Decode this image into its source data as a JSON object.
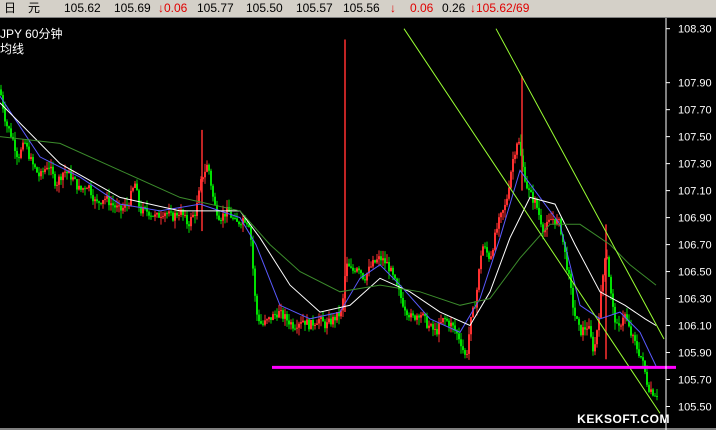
{
  "quote_bar": {
    "f1": "日",
    "f2": "元",
    "f3": "105.62",
    "f4": "105.69",
    "f5": "↓0.06",
    "f6": "105.77",
    "f7": "105.50",
    "f8": "105.57",
    "f9": "105.56",
    "f10": "↓",
    "f11": "0.06",
    "f12": "0.26",
    "f13": "↓105.62/69"
  },
  "chart_labels": {
    "symbol_period": "JPY  60分钟",
    "ma_label": "均线"
  },
  "watermark": "KEKSOFT.COM",
  "colors": {
    "up_candle": "#ff3030",
    "down_candle": "#00e000",
    "support_line": "#ff00ff",
    "channel": "#99ff33",
    "ma_fast": "#5a5aff",
    "ma_mid": "#ffffff",
    "ma_slow": "#3c8c2c",
    "axis": "#ffffff"
  },
  "chart_data": {
    "type": "candlestick",
    "period": "60分钟",
    "ylim": [
      105.45,
      108.35
    ],
    "y_ticks": [
      "108.30",
      "107.90",
      "107.70",
      "107.50",
      "107.30",
      "107.10",
      "106.90",
      "106.70",
      "106.50",
      "106.30",
      "106.10",
      "105.90",
      "105.70",
      "105.50"
    ],
    "close_path": [
      [
        0,
        107.85
      ],
      [
        6,
        107.6
      ],
      [
        12,
        107.5
      ],
      [
        18,
        107.35
      ],
      [
        25,
        107.45
      ],
      [
        32,
        107.3
      ],
      [
        40,
        107.2
      ],
      [
        48,
        107.3
      ],
      [
        56,
        107.15
      ],
      [
        64,
        107.25
      ],
      [
        72,
        107.2
      ],
      [
        80,
        107.1
      ],
      [
        88,
        107.15
      ],
      [
        96,
        107.0
      ],
      [
        104,
        107.05
      ],
      [
        112,
        107.0
      ],
      [
        120,
        106.95
      ],
      [
        128,
        107.0
      ],
      [
        135,
        107.15
      ],
      [
        140,
        106.95
      ],
      [
        148,
        106.95
      ],
      [
        156,
        106.9
      ],
      [
        164,
        106.95
      ],
      [
        172,
        106.9
      ],
      [
        180,
        106.95
      ],
      [
        188,
        106.85
      ],
      [
        196,
        106.95
      ],
      [
        202,
        107.2
      ],
      [
        208,
        107.3
      ],
      [
        214,
        107.0
      ],
      [
        220,
        106.9
      ],
      [
        228,
        106.95
      ],
      [
        236,
        106.85
      ],
      [
        244,
        106.9
      ],
      [
        250,
        106.85
      ],
      [
        256,
        106.2
      ],
      [
        262,
        106.1
      ],
      [
        270,
        106.15
      ],
      [
        278,
        106.2
      ],
      [
        286,
        106.15
      ],
      [
        294,
        106.1
      ],
      [
        302,
        106.15
      ],
      [
        310,
        106.1
      ],
      [
        318,
        106.15
      ],
      [
        326,
        106.1
      ],
      [
        334,
        106.15
      ],
      [
        342,
        106.2
      ],
      [
        346,
        106.55
      ],
      [
        352,
        106.5
      ],
      [
        358,
        106.55
      ],
      [
        364,
        106.45
      ],
      [
        372,
        106.55
      ],
      [
        380,
        106.6
      ],
      [
        388,
        106.55
      ],
      [
        396,
        106.4
      ],
      [
        404,
        106.25
      ],
      [
        412,
        106.15
      ],
      [
        420,
        106.2
      ],
      [
        428,
        106.1
      ],
      [
        436,
        106.05
      ],
      [
        444,
        106.15
      ],
      [
        452,
        106.1
      ],
      [
        460,
        106.0
      ],
      [
        466,
        105.85
      ],
      [
        470,
        106.1
      ],
      [
        476,
        106.3
      ],
      [
        482,
        106.7
      ],
      [
        490,
        106.6
      ],
      [
        498,
        106.85
      ],
      [
        506,
        107.0
      ],
      [
        512,
        107.3
      ],
      [
        518,
        107.5
      ],
      [
        522,
        107.3
      ],
      [
        528,
        107.1
      ],
      [
        536,
        107.0
      ],
      [
        544,
        106.8
      ],
      [
        552,
        106.9
      ],
      [
        560,
        106.85
      ],
      [
        568,
        106.5
      ],
      [
        574,
        106.2
      ],
      [
        580,
        106.05
      ],
      [
        588,
        106.1
      ],
      [
        594,
        105.9
      ],
      [
        600,
        106.25
      ],
      [
        606,
        106.7
      ],
      [
        612,
        106.25
      ],
      [
        618,
        106.05
      ],
      [
        624,
        106.2
      ],
      [
        630,
        106.05
      ],
      [
        636,
        105.95
      ],
      [
        642,
        105.85
      ],
      [
        648,
        105.65
      ],
      [
        654,
        105.6
      ],
      [
        658,
        105.6
      ]
    ],
    "support_level": 105.79,
    "channel_upper": [
      [
        404,
        108.3
      ],
      [
        660,
        105.45
      ]
    ],
    "channel_lower": [
      [
        496,
        108.3
      ],
      [
        664,
        106.0
      ]
    ],
    "moving_averages": [
      {
        "name": "MA fast",
        "points": [
          [
            0,
            107.8
          ],
          [
            40,
            107.35
          ],
          [
            80,
            107.2
          ],
          [
            120,
            107.0
          ],
          [
            160,
            106.95
          ],
          [
            200,
            107.0
          ],
          [
            240,
            106.9
          ],
          [
            256,
            106.7
          ],
          [
            280,
            106.25
          ],
          [
            310,
            106.15
          ],
          [
            340,
            106.2
          ],
          [
            360,
            106.45
          ],
          [
            380,
            106.55
          ],
          [
            400,
            106.4
          ],
          [
            430,
            106.15
          ],
          [
            460,
            106.05
          ],
          [
            480,
            106.3
          ],
          [
            500,
            106.75
          ],
          [
            520,
            107.25
          ],
          [
            540,
            107.05
          ],
          [
            560,
            106.85
          ],
          [
            580,
            106.25
          ],
          [
            600,
            106.15
          ],
          [
            620,
            106.2
          ],
          [
            640,
            106.05
          ],
          [
            656,
            105.8
          ]
        ]
      },
      {
        "name": "MA mid",
        "points": [
          [
            0,
            107.75
          ],
          [
            60,
            107.3
          ],
          [
            120,
            107.05
          ],
          [
            180,
            106.95
          ],
          [
            240,
            106.95
          ],
          [
            260,
            106.75
          ],
          [
            290,
            106.4
          ],
          [
            320,
            106.2
          ],
          [
            350,
            106.25
          ],
          [
            380,
            106.45
          ],
          [
            410,
            106.35
          ],
          [
            440,
            106.2
          ],
          [
            470,
            106.1
          ],
          [
            490,
            106.35
          ],
          [
            510,
            106.75
          ],
          [
            530,
            107.05
          ],
          [
            555,
            107.0
          ],
          [
            575,
            106.7
          ],
          [
            600,
            106.35
          ],
          [
            625,
            106.25
          ],
          [
            645,
            106.15
          ],
          [
            656,
            106.1
          ]
        ]
      },
      {
        "name": "MA slow",
        "points": [
          [
            0,
            107.5
          ],
          [
            60,
            107.45
          ],
          [
            120,
            107.25
          ],
          [
            180,
            107.05
          ],
          [
            240,
            106.95
          ],
          [
            270,
            106.7
          ],
          [
            300,
            106.5
          ],
          [
            340,
            106.35
          ],
          [
            380,
            106.4
          ],
          [
            420,
            106.35
          ],
          [
            460,
            106.25
          ],
          [
            490,
            106.3
          ],
          [
            520,
            106.6
          ],
          [
            550,
            106.85
          ],
          [
            580,
            106.85
          ],
          [
            610,
            106.7
          ],
          [
            630,
            106.55
          ],
          [
            656,
            106.4
          ]
        ]
      }
    ]
  }
}
